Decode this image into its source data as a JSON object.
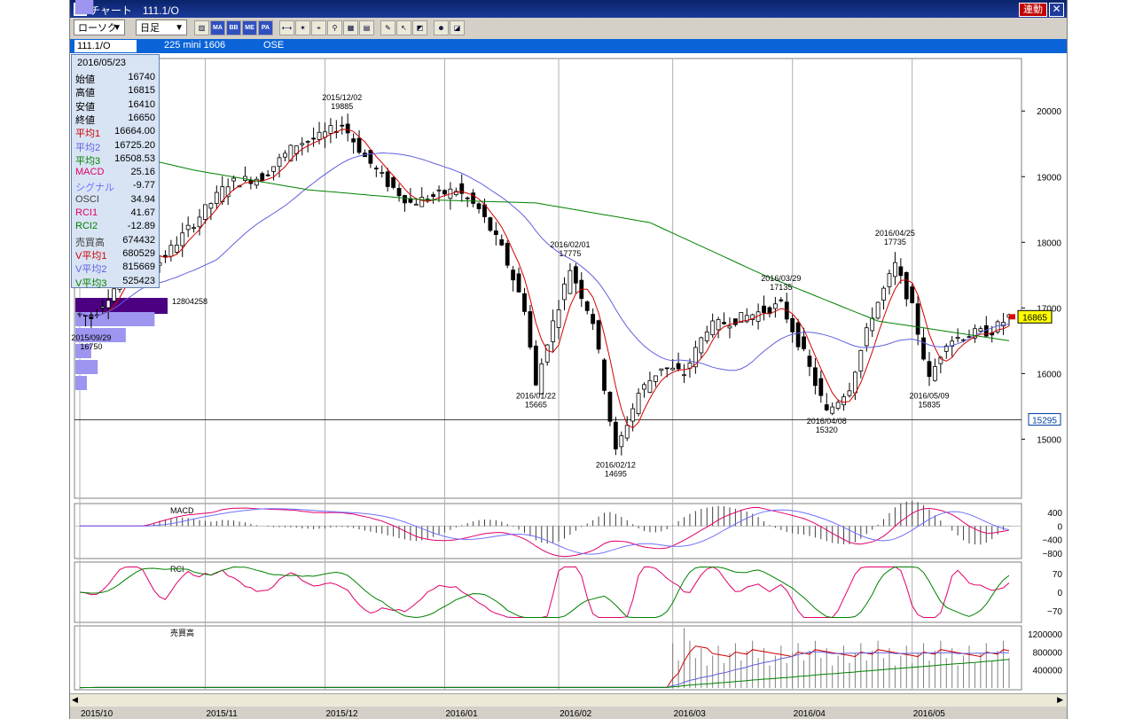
{
  "window": {
    "title": "チャート　111.1/O",
    "link_label": "連動",
    "close_label": "✕"
  },
  "toolbar": {
    "chart_type": "ローソク",
    "period": "日足",
    "buttons": [
      "bars-icon",
      "MA",
      "BB",
      "ME",
      "PA",
      "ruler-icon",
      "zoom-icon",
      "crosshair-icon",
      "search-icon",
      "grid-icon",
      "table-icon",
      "pencil-icon",
      "pointer-icon",
      "eraser-icon",
      "marker-icon",
      "color-icon"
    ]
  },
  "infobar": {
    "symbol": "111.1/O",
    "description": "225 mini 1606",
    "exchange": "OSE"
  },
  "infobox": {
    "date": "2016/05/23",
    "rows": [
      {
        "k": "始値",
        "v": "16740",
        "color": "#000000"
      },
      {
        "k": "高値",
        "v": "16815",
        "color": "#000000"
      },
      {
        "k": "安値",
        "v": "16410",
        "color": "#000000"
      },
      {
        "k": "終値",
        "v": "16650",
        "color": "#000000"
      },
      {
        "k": "平均1",
        "v": "16664.00",
        "color": "#d00000"
      },
      {
        "k": "平均2",
        "v": "16725.20",
        "color": "#6060e0"
      },
      {
        "k": "平均3",
        "v": "16508.53",
        "color": "#008000"
      },
      {
        "k": "MACD",
        "v": "25.16",
        "color": "#e0006a"
      },
      {
        "k": "シグナル",
        "v": "-9.77",
        "color": "#7070ff"
      },
      {
        "k": "OSCI",
        "v": "34.94",
        "color": "#404040"
      },
      {
        "k": "RCI1",
        "v": "41.67",
        "color": "#e0006a"
      },
      {
        "k": "RCI2",
        "v": "-12.89",
        "color": "#008000"
      },
      {
        "k": "売買高",
        "v": "674432",
        "color": "#404040"
      },
      {
        "k": "V平均1",
        "v": "680529",
        "color": "#d00000"
      },
      {
        "k": "V平均2",
        "v": "815669",
        "color": "#6060e0"
      },
      {
        "k": "V平均3",
        "v": "525423",
        "color": "#008000"
      }
    ]
  },
  "chart_data": {
    "type": "candlestick",
    "price_axis": {
      "ticks": [
        20000,
        19000,
        18000,
        17000,
        16000,
        15000
      ],
      "range": [
        14100,
        20800
      ]
    },
    "last_price_label": "16865",
    "hline_label": "15295",
    "hline_value": 15295,
    "profile_label": "12804258",
    "date_labels": [
      "2015/10",
      "2015/11",
      "2015/12",
      "2016/01",
      "2016/02",
      "2016/03",
      "2016/04",
      "2016/05"
    ],
    "annotations": [
      {
        "date": "2015/12/02",
        "value": "19885",
        "anchor_index": 46,
        "pos": "above"
      },
      {
        "date": "2015/09/29",
        "value": "16750",
        "anchor_index": 2,
        "pos": "below"
      },
      {
        "date": "2016/01/22",
        "value": "15665",
        "anchor_index": 80,
        "pos": "below"
      },
      {
        "date": "2016/02/01",
        "value": "17775",
        "anchor_index": 86,
        "pos": "above"
      },
      {
        "date": "2016/02/12",
        "value": "14695",
        "anchor_index": 94,
        "pos": "below"
      },
      {
        "date": "2016/03/29",
        "value": "17135",
        "anchor_index": 123,
        "pos": "above"
      },
      {
        "date": "2016/04/08",
        "value": "15320",
        "anchor_index": 131,
        "pos": "below"
      },
      {
        "date": "2016/04/25",
        "value": "17735",
        "anchor_index": 143,
        "pos": "above"
      },
      {
        "date": "2016/05/09",
        "value": "15835",
        "anchor_index": 149,
        "pos": "below"
      }
    ],
    "anchors": [
      {
        "i": 0,
        "c": 16900
      },
      {
        "i": 2,
        "c": 16850
      },
      {
        "i": 6,
        "c": 17300
      },
      {
        "i": 10,
        "c": 17900
      },
      {
        "i": 14,
        "c": 17700
      },
      {
        "i": 20,
        "c": 18300
      },
      {
        "i": 26,
        "c": 18900
      },
      {
        "i": 32,
        "c": 19000
      },
      {
        "i": 38,
        "c": 19500
      },
      {
        "i": 42,
        "c": 19600
      },
      {
        "i": 46,
        "c": 19800
      },
      {
        "i": 50,
        "c": 19300
      },
      {
        "i": 54,
        "c": 18900
      },
      {
        "i": 58,
        "c": 18600
      },
      {
        "i": 62,
        "c": 18700
      },
      {
        "i": 66,
        "c": 18800
      },
      {
        "i": 70,
        "c": 18500
      },
      {
        "i": 74,
        "c": 17900
      },
      {
        "i": 78,
        "c": 17000
      },
      {
        "i": 80,
        "c": 15800
      },
      {
        "i": 82,
        "c": 16500
      },
      {
        "i": 86,
        "c": 17600
      },
      {
        "i": 90,
        "c": 16800
      },
      {
        "i": 94,
        "c": 14800
      },
      {
        "i": 98,
        "c": 15700
      },
      {
        "i": 102,
        "c": 16100
      },
      {
        "i": 106,
        "c": 16000
      },
      {
        "i": 110,
        "c": 16700
      },
      {
        "i": 114,
        "c": 16800
      },
      {
        "i": 118,
        "c": 16900
      },
      {
        "i": 123,
        "c": 17050
      },
      {
        "i": 127,
        "c": 16300
      },
      {
        "i": 131,
        "c": 15400
      },
      {
        "i": 135,
        "c": 15800
      },
      {
        "i": 139,
        "c": 16900
      },
      {
        "i": 143,
        "c": 17650
      },
      {
        "i": 146,
        "c": 17000
      },
      {
        "i": 149,
        "c": 15900
      },
      {
        "i": 152,
        "c": 16500
      },
      {
        "i": 156,
        "c": 16600
      },
      {
        "i": 160,
        "c": 16650
      },
      {
        "i": 163,
        "c": 16865
      }
    ],
    "ma_long_anchors": [
      {
        "i": 0,
        "v": 19500
      },
      {
        "i": 20,
        "v": 19100
      },
      {
        "i": 40,
        "v": 18800
      },
      {
        "i": 60,
        "v": 18650
      },
      {
        "i": 80,
        "v": 18600
      },
      {
        "i": 100,
        "v": 18300
      },
      {
        "i": 120,
        "v": 17500
      },
      {
        "i": 140,
        "v": 16800
      },
      {
        "i": 163,
        "v": 16500
      }
    ],
    "volume_profile": [
      12804258,
      11000000,
      7000000,
      2200000,
      3100000,
      1600000,
      2500000
    ],
    "macd": {
      "label": "MACD",
      "ticks": [
        "400",
        "0",
        "−400",
        "−800"
      ],
      "tick_values": [
        400,
        0,
        -400,
        -800
      ]
    },
    "rci": {
      "label": "RCI",
      "ticks": [
        "70",
        "0",
        "−70"
      ],
      "tick_values": [
        70,
        0,
        -70
      ]
    },
    "volume": {
      "label": "売買高",
      "ticks": [
        "1200000",
        "800000",
        "400000"
      ],
      "tick_values": [
        1200000,
        800000,
        400000
      ]
    }
  }
}
